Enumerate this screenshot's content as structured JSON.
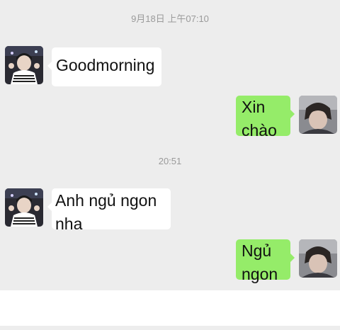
{
  "chat": {
    "timestamps": [
      "9月18日 上午07:10",
      "20:51"
    ],
    "messages": [
      {
        "side": "left",
        "text": "Goodmorning"
      },
      {
        "side": "right",
        "text": "Xin chào"
      },
      {
        "side": "left",
        "text": "Anh ngủ ngon nha"
      },
      {
        "side": "right",
        "text": "Ngủ ngon"
      }
    ]
  },
  "colors": {
    "background": "#ededed",
    "bubble_self": "#95ec69",
    "bubble_other": "#ffffff",
    "timestamp_text": "#9a9a9a"
  },
  "icons": {
    "contact_avatar": "avatar-photo-contact",
    "self_avatar": "avatar-photo-self"
  }
}
